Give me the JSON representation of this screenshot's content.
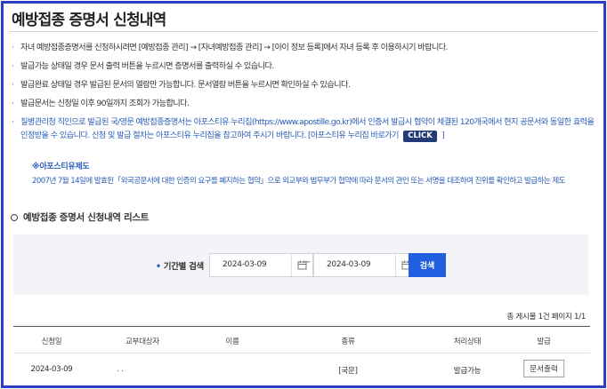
{
  "page": {
    "title": "예방접종 증명서 신청내역"
  },
  "notes": [
    "자녀 예방접종증명서를 신청하시려면 [예방접종 관리] → [자녀예방접종 관리] → [아이 정보 등록]에서 자녀 등록 후 이용하시기 바랍니다.",
    "발급가능 상태일 경우 문서 출력 버튼을 누르시면 증명서를 출력하실 수 있습니다.",
    "발급완료 상태일 경우 발급된 문서의 열람만 가능합니다. 문서열람 버튼을 누르시면 확인하실 수 있습니다.",
    "발급문서는 신청일 이후 90일까지 조회가 가능합니다."
  ],
  "apostille": {
    "text_before": "질병관리청 직인으로 발급된 국/영문 예방접종증명서는 아포스티유 누리집(https://www.apostille.go.kr)에서 인증서 발급시 협약이 체결된 120개국에서 현지 공문서와 동일한 효력을 인정받을 수 있습니다. 신청 및 발급 절차는 아포스티유 누리집을 참고하여 주시기 바랍니다. [아포스티유 누리집 바로가기",
    "click_label": "CLICK",
    "text_after": "]",
    "sub_title": "※아포스티유제도",
    "sub_text": "2007년 7월 14일에 발효된「외국공문서에 대한 인증의 요구를 폐지하는 협약」으로 외교부와 법무부가 협약에 따라 문서의 관인 또는 서명을 대조하여 진위를 확인하고 발급하는 제도"
  },
  "list": {
    "title": "예방접종 증명서 신청내역 리스트"
  },
  "search": {
    "period_label": "기간별 검색",
    "start_date": "2024-03-09",
    "end_date": "2024-03-09",
    "separator": "~",
    "button_label": "검색"
  },
  "summary": {
    "text": "총 게시물 1건   페이지 1/1"
  },
  "table": {
    "headers": [
      "신청일",
      "교부대상자",
      "이름",
      "종류",
      "처리상태",
      "발급"
    ],
    "rows": [
      {
        "date": "2024-03-09",
        "target": ". .",
        "name": "",
        "type": "[국문]",
        "status": "발급가능",
        "action": "문서출력"
      }
    ]
  },
  "colors": {
    "frame": "#2b3ec4",
    "accent_blue": "#2a5db8",
    "search_button": "#1f5fe0",
    "click_badge": "#233b78"
  }
}
